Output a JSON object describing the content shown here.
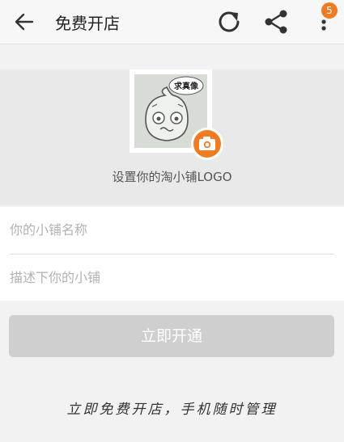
{
  "header": {
    "title": "免费开店",
    "back_icon": "arrow-left-icon",
    "refresh_icon": "refresh-icon",
    "share_icon": "share-icon",
    "more_icon": "more-vertical-icon",
    "badge_count": "5"
  },
  "logo": {
    "bubble_text": "求真像",
    "label": "设置你的淘小铺LOGO",
    "camera_icon": "camera-icon"
  },
  "form": {
    "name_placeholder": "你的小铺名称",
    "desc_placeholder": "描述下你的小铺"
  },
  "submit": {
    "label": "立即开通"
  },
  "slogan": "立即免费开店，手机随时管理",
  "colors": {
    "accent": "#f07b22",
    "disabled_button": "#cfcfcf",
    "background": "#f2f2f2"
  }
}
